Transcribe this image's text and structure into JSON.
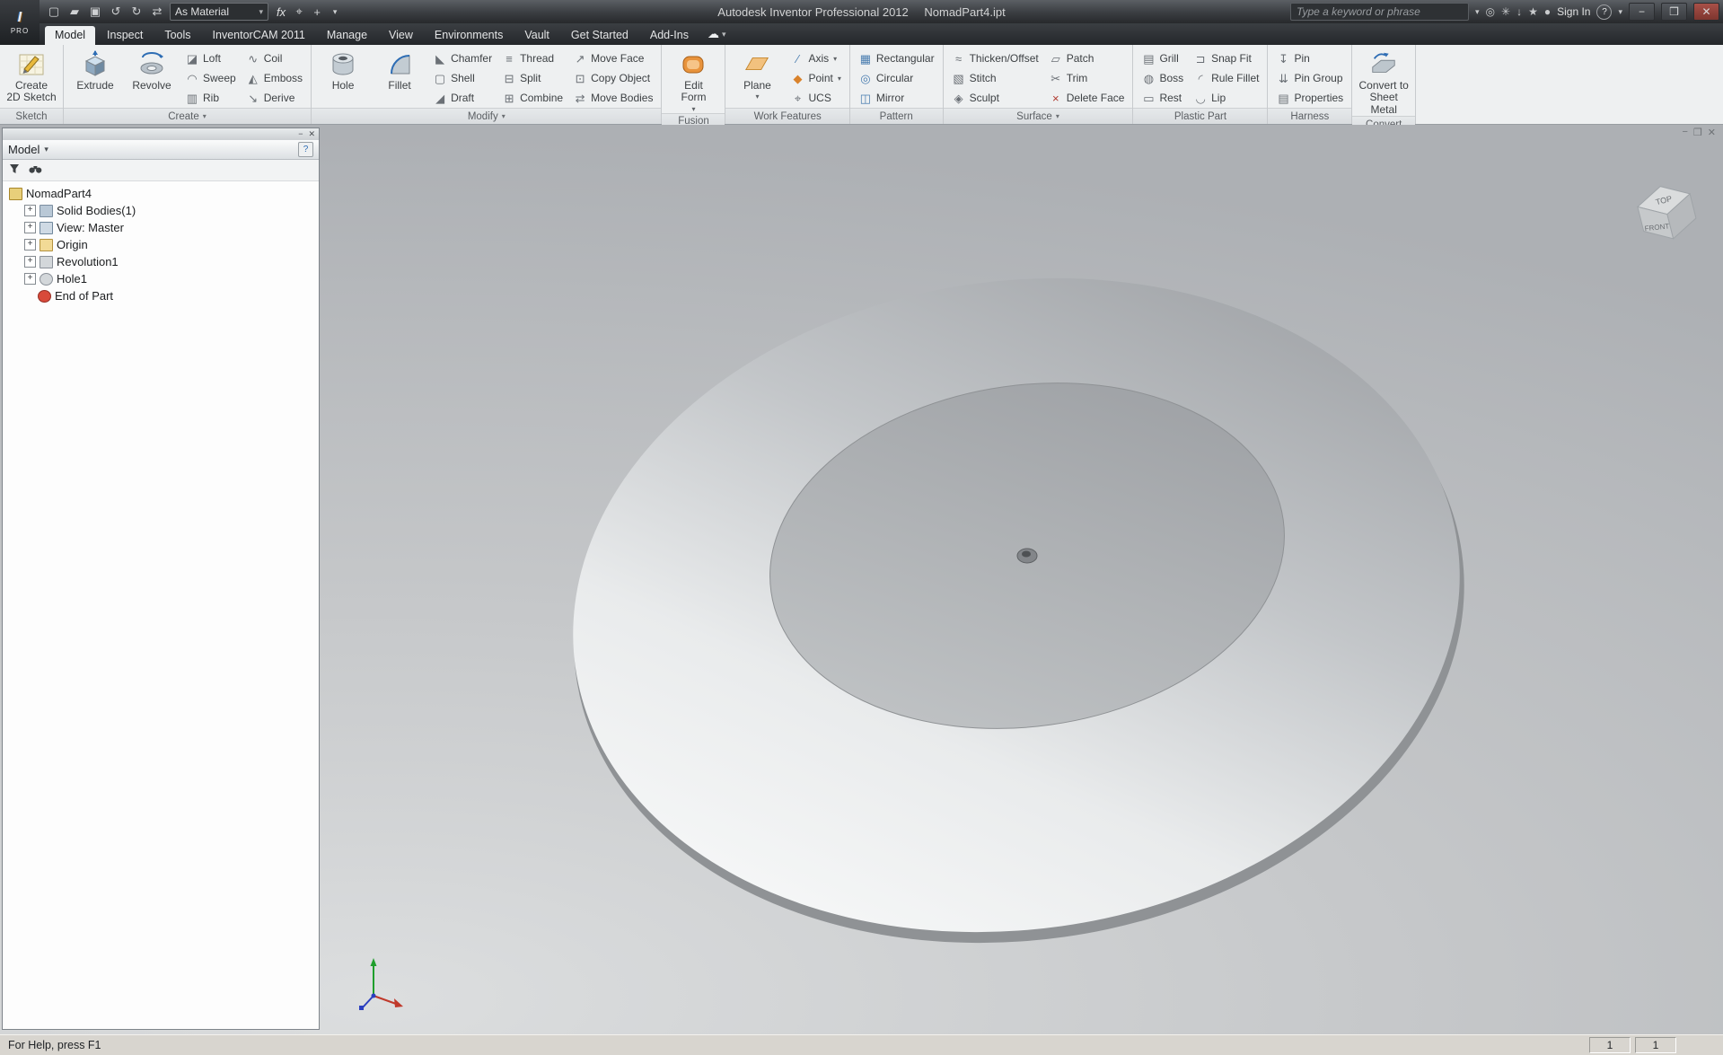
{
  "titlebar": {
    "logo_text": "PRO",
    "app_title": "Autodesk Inventor Professional 2012",
    "doc_title": "NomadPart4.ipt",
    "qat_icons": [
      "new-file",
      "open-file",
      "save",
      "undo",
      "redo",
      "update"
    ],
    "material_combo_value": "As Material",
    "fx_label": "fx",
    "search_placeholder": "Type a keyword or phrase",
    "right_icons": [
      "community-search",
      "tools",
      "download",
      "favorites",
      "user"
    ],
    "sign_in_label": "Sign In",
    "help_label": "?"
  },
  "tabs": {
    "active": "Model",
    "items": [
      "Model",
      "Inspect",
      "Tools",
      "InventorCAM 2011",
      "Manage",
      "View",
      "Environments",
      "Vault",
      "Get Started",
      "Add-Ins"
    ]
  },
  "ribbon": {
    "panels": [
      {
        "label": "Sketch",
        "has_arrow": false,
        "big": [
          {
            "label": "Create\n2D Sketch",
            "icon": "create-2d-sketch"
          }
        ],
        "cols": []
      },
      {
        "label": "Create",
        "has_arrow": true,
        "big": [
          {
            "label": "Extrude",
            "icon": "extrude"
          },
          {
            "label": "Revolve",
            "icon": "revolve"
          }
        ],
        "cols": [
          [
            {
              "label": "Loft",
              "icon": "loft"
            },
            {
              "label": "Sweep",
              "icon": "sweep"
            },
            {
              "label": "Rib",
              "icon": "rib"
            }
          ],
          [
            {
              "label": "Coil",
              "icon": "coil"
            },
            {
              "label": "Emboss",
              "icon": "emboss"
            },
            {
              "label": "Derive",
              "icon": "derive"
            }
          ]
        ]
      },
      {
        "label": "Modify",
        "has_arrow": true,
        "big": [
          {
            "label": "Hole",
            "icon": "hole"
          },
          {
            "label": "Fillet",
            "icon": "fillet"
          }
        ],
        "cols": [
          [
            {
              "label": "Chamfer",
              "icon": "chamfer"
            },
            {
              "label": "Shell",
              "icon": "shell"
            },
            {
              "label": "Draft",
              "icon": "draft"
            }
          ],
          [
            {
              "label": "Thread",
              "icon": "thread"
            },
            {
              "label": "Split",
              "icon": "split"
            },
            {
              "label": "Combine",
              "icon": "combine"
            }
          ],
          [
            {
              "label": "Move Face",
              "icon": "move-face"
            },
            {
              "label": "Copy Object",
              "icon": "copy-object"
            },
            {
              "label": "Move Bodies",
              "icon": "move-bodies"
            }
          ]
        ]
      },
      {
        "label": "Fusion",
        "has_arrow": false,
        "big": [
          {
            "label": "Edit\nForm",
            "icon": "edit-form",
            "arrow": true
          }
        ],
        "cols": []
      },
      {
        "label": "Work Features",
        "has_arrow": false,
        "big": [
          {
            "label": "Plane",
            "icon": "plane",
            "arrow": true
          }
        ],
        "cols": [
          [
            {
              "label": "Axis",
              "icon": "axis",
              "arrow": true
            },
            {
              "label": "Point",
              "icon": "point",
              "arrow": true
            },
            {
              "label": "UCS",
              "icon": "ucs"
            }
          ]
        ]
      },
      {
        "label": "Pattern",
        "has_arrow": false,
        "big": [],
        "cols": [
          [
            {
              "label": "Rectangular",
              "icon": "rectangular"
            },
            {
              "label": "Circular",
              "icon": "circular"
            },
            {
              "label": "Mirror",
              "icon": "mirror"
            }
          ]
        ]
      },
      {
        "label": "Surface",
        "has_arrow": true,
        "big": [],
        "cols": [
          [
            {
              "label": "Thicken/Offset",
              "icon": "thicken-offset"
            },
            {
              "label": "Stitch",
              "icon": "stitch"
            },
            {
              "label": "Sculpt",
              "icon": "sculpt"
            }
          ],
          [
            {
              "label": "Patch",
              "icon": "patch"
            },
            {
              "label": "Trim",
              "icon": "trim"
            },
            {
              "label": "Delete Face",
              "icon": "delete-face"
            }
          ]
        ]
      },
      {
        "label": "Plastic Part",
        "has_arrow": false,
        "big": [],
        "cols": [
          [
            {
              "label": "Grill",
              "icon": "grill"
            },
            {
              "label": "Boss",
              "icon": "boss"
            },
            {
              "label": "Rest",
              "icon": "rest"
            }
          ],
          [
            {
              "label": "Snap Fit",
              "icon": "snap-fit"
            },
            {
              "label": "Rule Fillet",
              "icon": "rule-fillet"
            },
            {
              "label": "Lip",
              "icon": "lip"
            }
          ]
        ]
      },
      {
        "label": "Harness",
        "has_arrow": false,
        "big": [],
        "cols": [
          [
            {
              "label": "Pin",
              "icon": "pin"
            },
            {
              "label": "Pin Group",
              "icon": "pin-group"
            },
            {
              "label": "Properties",
              "icon": "properties"
            }
          ]
        ]
      },
      {
        "label": "Convert",
        "has_arrow": false,
        "big": [
          {
            "label": "Convert to\nSheet Metal",
            "icon": "convert-sheet-metal"
          }
        ],
        "cols": []
      }
    ]
  },
  "browser": {
    "panel_title": "Model",
    "tree": [
      {
        "label": "NomadPart4",
        "icon": "part-document",
        "expandable": false,
        "level": 0
      },
      {
        "label": "Solid Bodies(1)",
        "icon": "solid-bodies-folder",
        "expandable": true,
        "level": 1
      },
      {
        "label": "View: Master",
        "icon": "view-representation",
        "expandable": true,
        "level": 1
      },
      {
        "label": "Origin",
        "icon": "origin-folder",
        "expandable": true,
        "level": 1
      },
      {
        "label": "Revolution1",
        "icon": "revolution-feature",
        "expandable": true,
        "level": 1
      },
      {
        "label": "Hole1",
        "icon": "hole-feature",
        "expandable": true,
        "level": 1
      },
      {
        "label": "End of Part",
        "icon": "end-of-part-marker",
        "expandable": false,
        "level": 1
      }
    ]
  },
  "viewport": {
    "viewcube": {
      "top_label": "TOP",
      "front_label": "FRONT"
    }
  },
  "colors": {
    "axis_x": "#c0392b",
    "axis_y": "#1f9e2c",
    "axis_z": "#2b3fbf"
  },
  "statusbar": {
    "help_text": "For Help, press F1",
    "cells": [
      "1",
      "1"
    ]
  }
}
